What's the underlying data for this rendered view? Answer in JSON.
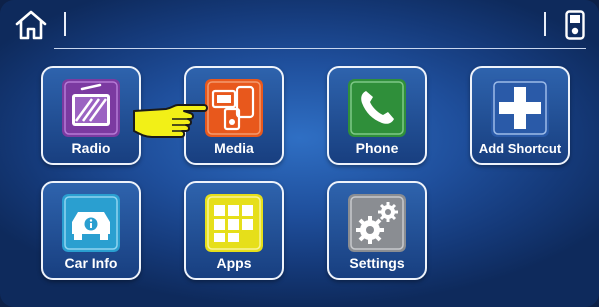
{
  "tiles": {
    "radio": {
      "label": "Radio",
      "icon": "radio-icon",
      "color": "#7b3aa1"
    },
    "media": {
      "label": "Media",
      "icon": "media-devices-icon",
      "color": "#e8581c"
    },
    "phone": {
      "label": "Phone",
      "icon": "phone-handset-icon",
      "color": "#2f8f3a"
    },
    "shortcut": {
      "label": "Add Shortcut",
      "icon": "plus-icon",
      "color": "#2a5aa8"
    },
    "carinfo": {
      "label": "Car Info",
      "icon": "car-info-icon",
      "color": "#2a9fd0"
    },
    "apps": {
      "label": "Apps",
      "icon": "apps-grid-icon",
      "color": "#e6df1a"
    },
    "settings": {
      "label": "Settings",
      "icon": "gears-icon",
      "color": "#8a8d92"
    }
  },
  "topbar": {
    "home_icon": "home-icon",
    "device_icon": "ipod-icon"
  },
  "pointer": {
    "icon": "pointing-hand-icon",
    "color": "#f2f017"
  }
}
